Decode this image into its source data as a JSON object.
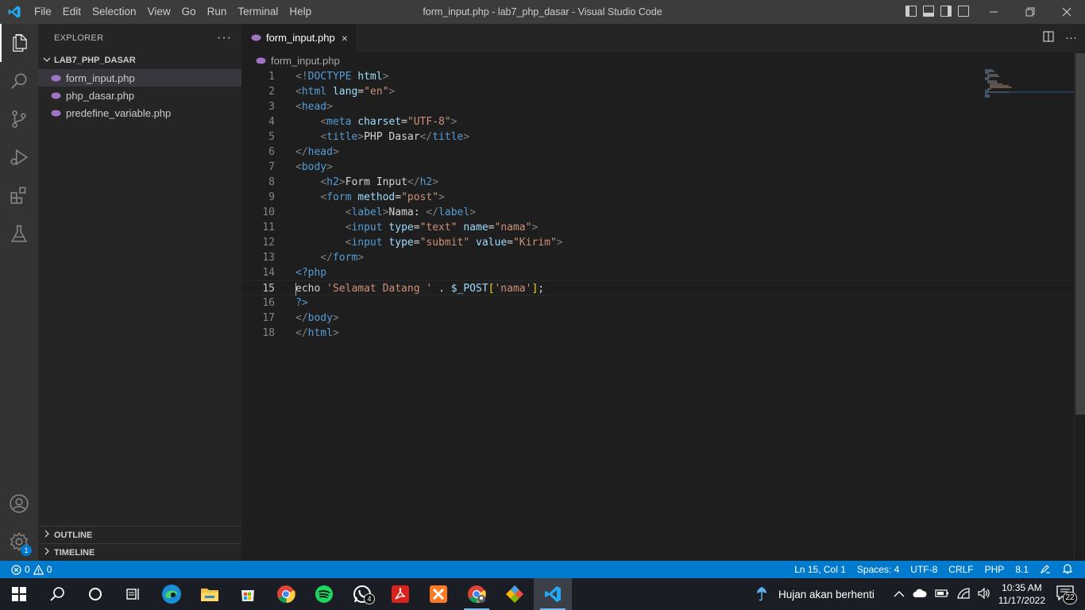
{
  "titlebar": {
    "menu": [
      "File",
      "Edit",
      "Selection",
      "View",
      "Go",
      "Run",
      "Terminal",
      "Help"
    ],
    "title": "form_input.php - lab7_php_dasar - Visual Studio Code"
  },
  "activitybar": {
    "items": [
      "explorer-icon",
      "search-icon",
      "source-control-icon",
      "run-debug-icon",
      "extensions-icon",
      "testing-icon"
    ],
    "bottom": [
      "accounts-icon",
      "manage-gear-icon"
    ],
    "manage_badge": "1"
  },
  "sidebar": {
    "header": "EXPLORER",
    "more": "···",
    "folder": "LAB7_PHP_DASAR",
    "files": [
      {
        "name": "form_input.php",
        "selected": true
      },
      {
        "name": "php_dasar.php",
        "selected": false
      },
      {
        "name": "predefine_variable.php",
        "selected": false
      }
    ],
    "outline": "OUTLINE",
    "timeline": "TIMELINE"
  },
  "editor": {
    "tab_label": "form_input.php",
    "close_glyph": "×",
    "breadcrumb": "form_input.php",
    "current_line": 15,
    "lines": [
      [
        {
          "c": "t-tag",
          "t": "<!"
        },
        {
          "c": "t-name",
          "t": "DOCTYPE"
        },
        {
          "c": "t-txt",
          "t": " "
        },
        {
          "c": "t-attr",
          "t": "html"
        },
        {
          "c": "t-tag",
          "t": ">"
        }
      ],
      [
        {
          "c": "t-tag",
          "t": "<"
        },
        {
          "c": "t-name",
          "t": "html"
        },
        {
          "c": "t-txt",
          "t": " "
        },
        {
          "c": "t-attr",
          "t": "lang"
        },
        {
          "c": "t-txt",
          "t": "="
        },
        {
          "c": "t-str",
          "t": "\"en\""
        },
        {
          "c": "t-tag",
          "t": ">"
        }
      ],
      [
        {
          "c": "t-tag",
          "t": "<"
        },
        {
          "c": "t-name",
          "t": "head"
        },
        {
          "c": "t-tag",
          "t": ">"
        }
      ],
      [
        {
          "c": "t-txt",
          "t": "    "
        },
        {
          "c": "t-tag",
          "t": "<"
        },
        {
          "c": "t-name",
          "t": "meta"
        },
        {
          "c": "t-txt",
          "t": " "
        },
        {
          "c": "t-attr",
          "t": "charset"
        },
        {
          "c": "t-txt",
          "t": "="
        },
        {
          "c": "t-str",
          "t": "\"UTF-8\""
        },
        {
          "c": "t-tag",
          "t": ">"
        }
      ],
      [
        {
          "c": "t-txt",
          "t": "    "
        },
        {
          "c": "t-tag",
          "t": "<"
        },
        {
          "c": "t-name",
          "t": "title"
        },
        {
          "c": "t-tag",
          "t": ">"
        },
        {
          "c": "t-txt",
          "t": "PHP Dasar"
        },
        {
          "c": "t-tag",
          "t": "</"
        },
        {
          "c": "t-name",
          "t": "title"
        },
        {
          "c": "t-tag",
          "t": ">"
        }
      ],
      [
        {
          "c": "t-tag",
          "t": "</"
        },
        {
          "c": "t-name",
          "t": "head"
        },
        {
          "c": "t-tag",
          "t": ">"
        }
      ],
      [
        {
          "c": "t-tag",
          "t": "<"
        },
        {
          "c": "t-name",
          "t": "body"
        },
        {
          "c": "t-tag",
          "t": ">"
        }
      ],
      [
        {
          "c": "t-txt",
          "t": "    "
        },
        {
          "c": "t-tag",
          "t": "<"
        },
        {
          "c": "t-name",
          "t": "h2"
        },
        {
          "c": "t-tag",
          "t": ">"
        },
        {
          "c": "t-txt",
          "t": "Form Input"
        },
        {
          "c": "t-tag",
          "t": "</"
        },
        {
          "c": "t-name",
          "t": "h2"
        },
        {
          "c": "t-tag",
          "t": ">"
        }
      ],
      [
        {
          "c": "t-txt",
          "t": "    "
        },
        {
          "c": "t-tag",
          "t": "<"
        },
        {
          "c": "t-name",
          "t": "form"
        },
        {
          "c": "t-txt",
          "t": " "
        },
        {
          "c": "t-attr",
          "t": "method"
        },
        {
          "c": "t-txt",
          "t": "="
        },
        {
          "c": "t-str",
          "t": "\"post\""
        },
        {
          "c": "t-tag",
          "t": ">"
        }
      ],
      [
        {
          "c": "t-txt",
          "t": "        "
        },
        {
          "c": "t-tag",
          "t": "<"
        },
        {
          "c": "t-name",
          "t": "label"
        },
        {
          "c": "t-tag",
          "t": ">"
        },
        {
          "c": "t-txt",
          "t": "Nama: "
        },
        {
          "c": "t-tag",
          "t": "</"
        },
        {
          "c": "t-name",
          "t": "label"
        },
        {
          "c": "t-tag",
          "t": ">"
        }
      ],
      [
        {
          "c": "t-txt",
          "t": "        "
        },
        {
          "c": "t-tag",
          "t": "<"
        },
        {
          "c": "t-name",
          "t": "input"
        },
        {
          "c": "t-txt",
          "t": " "
        },
        {
          "c": "t-attr",
          "t": "type"
        },
        {
          "c": "t-txt",
          "t": "="
        },
        {
          "c": "t-str",
          "t": "\"text\""
        },
        {
          "c": "t-txt",
          "t": " "
        },
        {
          "c": "t-attr",
          "t": "name"
        },
        {
          "c": "t-txt",
          "t": "="
        },
        {
          "c": "t-str",
          "t": "\"nama\""
        },
        {
          "c": "t-tag",
          "t": ">"
        }
      ],
      [
        {
          "c": "t-txt",
          "t": "        "
        },
        {
          "c": "t-tag",
          "t": "<"
        },
        {
          "c": "t-name",
          "t": "input"
        },
        {
          "c": "t-txt",
          "t": " "
        },
        {
          "c": "t-attr",
          "t": "type"
        },
        {
          "c": "t-txt",
          "t": "="
        },
        {
          "c": "t-str",
          "t": "\"submit\""
        },
        {
          "c": "t-txt",
          "t": " "
        },
        {
          "c": "t-attr",
          "t": "value"
        },
        {
          "c": "t-txt",
          "t": "="
        },
        {
          "c": "t-str",
          "t": "\"Kirim\""
        },
        {
          "c": "t-tag",
          "t": ">"
        }
      ],
      [
        {
          "c": "t-txt",
          "t": "    "
        },
        {
          "c": "t-tag",
          "t": "</"
        },
        {
          "c": "t-name",
          "t": "form"
        },
        {
          "c": "t-tag",
          "t": ">"
        }
      ],
      [
        {
          "c": "t-php",
          "t": "<?php"
        }
      ],
      [
        {
          "c": "t-txt",
          "t": "echo"
        },
        {
          "c": "t-txt",
          "t": " "
        },
        {
          "c": "t-str",
          "t": "'Selamat Datang '"
        },
        {
          "c": "t-txt",
          "t": " . "
        },
        {
          "c": "t-var",
          "t": "$_POST"
        },
        {
          "c": "t-br",
          "t": "["
        },
        {
          "c": "t-str",
          "t": "'nama'"
        },
        {
          "c": "t-br",
          "t": "]"
        },
        {
          "c": "t-txt",
          "t": ";"
        }
      ],
      [
        {
          "c": "t-php",
          "t": "?>"
        }
      ],
      [
        {
          "c": "t-tag",
          "t": "</"
        },
        {
          "c": "t-name",
          "t": "body"
        },
        {
          "c": "t-tag",
          "t": ">"
        }
      ],
      [
        {
          "c": "t-tag",
          "t": "</"
        },
        {
          "c": "t-name",
          "t": "html"
        },
        {
          "c": "t-tag",
          "t": ">"
        }
      ]
    ]
  },
  "statusbar": {
    "errors": "0",
    "warnings": "0",
    "position": "Ln 15, Col 1",
    "spaces": "Spaces: 4",
    "encoding": "UTF-8",
    "eol": "CRLF",
    "language": "PHP",
    "version": "8.1"
  },
  "taskbar": {
    "apps": [
      "windows-start-icon",
      "search-icon",
      "cortana-icon",
      "task-view-icon",
      "edge-icon",
      "file-explorer-icon",
      "microsoft-store-icon",
      "chrome-icon",
      "spotify-icon",
      "whatsapp-icon",
      "acrobat-icon",
      "xampp-icon",
      "chrome-profile-icon",
      "git-icon",
      "vscode-icon"
    ],
    "whatsapp_badge": "4",
    "weather": "Hujan akan berhenti",
    "time": "10:35 AM",
    "date": "11/17/2022",
    "notification_count": "22"
  },
  "colors": {
    "accent": "#007acc",
    "titlebar": "#3c3c3c",
    "activitybar": "#333333",
    "sidebar": "#252526",
    "editor": "#1e1e1e"
  }
}
